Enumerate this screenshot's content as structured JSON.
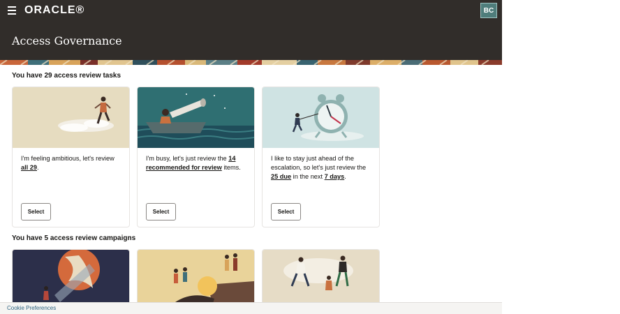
{
  "topbar": {
    "logo": "ORACLE®",
    "avatar_initials": "BC"
  },
  "header": {
    "title": "Access Governance"
  },
  "tasks": {
    "heading": "You have 29 access review tasks",
    "cards": [
      {
        "text_pre": "I'm feeling ambitious, let's review ",
        "link": "all 29",
        "text_post": ".",
        "button": "Select"
      },
      {
        "text_pre": "I'm busy, let's just review the ",
        "link": "14 recommended for review",
        "text_post": " items.",
        "button": "Select"
      },
      {
        "text_pre": "I like to stay just ahead of the escalation, so let's just review the ",
        "link": "25 due",
        "text_mid": " in the next ",
        "link2": "7 days",
        "text_post": ".",
        "button": "Select"
      }
    ]
  },
  "campaigns": {
    "heading": "You have 5 access review campaigns"
  },
  "footer": {
    "cookie_link": "Cookie Preferences"
  },
  "colors": {
    "header_bg": "#312d2a",
    "avatar_bg": "#4f7d7b",
    "link": "#2e6380"
  }
}
